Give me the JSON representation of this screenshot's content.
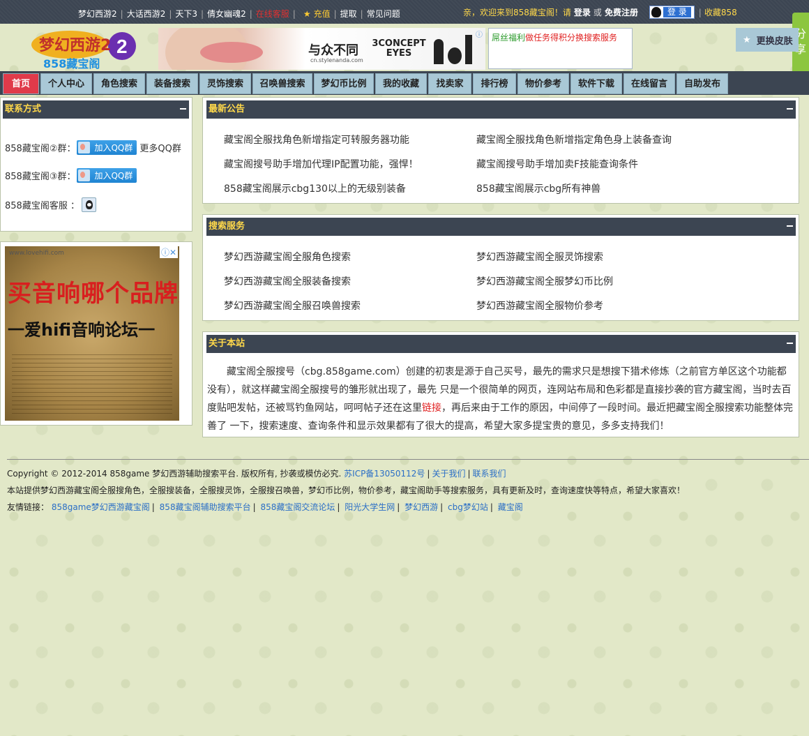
{
  "topbar": {
    "links": [
      "梦幻西游2",
      "大话西游2",
      "天下3",
      "倩女幽魂2",
      "在线客服",
      "充值",
      "提取",
      "常见问题"
    ],
    "welcome": "亲，欢迎来到858藏宝阁！请",
    "login": "登录",
    "or": "或",
    "register": "免费注册",
    "qq_login": "登 录",
    "favorite": "收藏858"
  },
  "header": {
    "logo_text": "858藏宝阁",
    "logo_mark": "梦幻西游2",
    "ad": {
      "slogan": "与众不同",
      "brand": "3CONCEPT EYES",
      "url": "cn.stylenanda.com"
    },
    "notice": {
      "green": "屌丝福利",
      "red": "做任务得积分换搜索服务"
    },
    "skin": "更换皮肤",
    "share": "分享"
  },
  "nav": [
    "首页",
    "个人中心",
    "角色搜索",
    "装备搜索",
    "灵饰搜索",
    "召唤兽搜索",
    "梦幻币比例",
    "我的收藏",
    "找卖家",
    "排行榜",
    "物价参考",
    "软件下载",
    "在线留言",
    "自助发布"
  ],
  "contact": {
    "title": "联系方式",
    "group2": "858藏宝阁②群：",
    "group3": "858藏宝阁③群：",
    "service": "858藏宝阁客服 ：",
    "join_qq": "加入QQ群",
    "more_qq": "更多QQ群"
  },
  "side_ad": {
    "url": "www.lovehifi.com",
    "headline": "买音响哪个品牌好?",
    "subline": "一爱hifi音响论坛一"
  },
  "news": {
    "title": "最新公告",
    "items": [
      "藏宝阁全服找角色新增指定可转服务器功能",
      "藏宝阁全服找角色新增指定角色身上装备查询",
      "藏宝阁搜号助手增加代理IP配置功能，强悍！",
      "藏宝阁搜号助手增加卖F技能查询条件",
      "858藏宝阁展示cbg130以上的无级别装备",
      "858藏宝阁展示cbg所有神兽"
    ]
  },
  "search": {
    "title": "搜索服务",
    "items": [
      "梦幻西游藏宝阁全服角色搜索",
      "梦幻西游藏宝阁全服灵饰搜索",
      "梦幻西游藏宝阁全服装备搜索",
      "梦幻西游藏宝阁全服梦幻币比例",
      "梦幻西游藏宝阁全服召唤兽搜索",
      "梦幻西游藏宝阁全服物价参考"
    ]
  },
  "about": {
    "title": "关于本站",
    "text_before": "藏宝阁全服搜号（cbg.858game.com）创建的初衷是源于自己买号，最先的需求只是想搜下猎术修炼（之前官方单区这个功能都没有），就这样藏宝阁全服搜号的雏形就出现了，最先 只是一个很简单的网页，连网站布局和色彩都是直接抄袭的官方藏宝阁，当时去百度贴吧发帖，还被骂钓鱼网站，呵呵帖子还在这里",
    "link": "链接",
    "text_after": "，再后来由于工作的原因，中间停了一段时间。最近把藏宝阁全服搜索功能整体完善了 一下，搜索速度、查询条件和显示效果都有了很大的提高，希望大家多提宝贵的意见，多多支持我们！"
  },
  "footer": {
    "copyright": "Copyright © 2012-2014 858game 梦幻西游辅助搜索平台. 版权所有, 抄袭或模仿必究.",
    "icp": "苏ICP备13050112号",
    "about": "关于我们",
    "contact": "联系我们",
    "desc": "本站提供梦幻西游藏宝阁全服搜角色，全服搜装备，全服搜灵饰，全服搜召唤兽，梦幻币比例，物价参考，藏宝阁助手等搜索服务，具有更新及时，查询速度快等特点，希望大家喜欢！",
    "friend_label": "友情链接：",
    "friends": [
      "858game梦幻西游藏宝阁",
      "858藏宝阁辅助搜索平台",
      "858藏宝阁交流论坛",
      "阳光大学生网",
      "梦幻西游",
      "cbg梦幻站",
      "藏宝阁"
    ]
  },
  "colors": {
    "dark": "#3c4552",
    "accent_yellow": "#ffd84a",
    "nav_blue": "#a9c8d6",
    "active_red": "#e03a4a",
    "link_blue": "#2a6ec6"
  }
}
